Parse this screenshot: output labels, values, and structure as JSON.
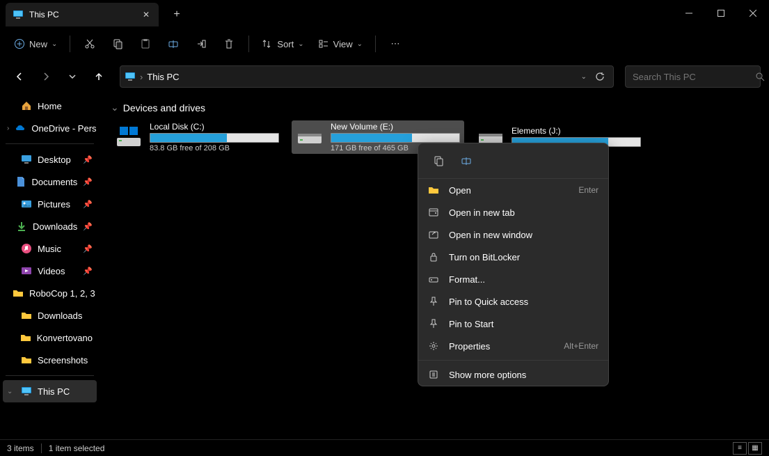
{
  "tab": {
    "title": "This PC"
  },
  "toolbar": {
    "new_label": "New",
    "sort_label": "Sort",
    "view_label": "View"
  },
  "address": {
    "location": "This PC",
    "separator": "›"
  },
  "search": {
    "placeholder": "Search This PC"
  },
  "sidebar": {
    "home": "Home",
    "onedrive": "OneDrive - Pers",
    "desktop": "Desktop",
    "documents": "Documents",
    "pictures": "Pictures",
    "downloads": "Downloads",
    "music": "Music",
    "videos": "Videos",
    "robocop": "RoboCop 1, 2, 3",
    "downloads2": "Downloads",
    "konvertovano": "Konvertovano",
    "screenshots": "Screenshots",
    "thispc": "This PC"
  },
  "group": {
    "title": "Devices and drives"
  },
  "drives": [
    {
      "name": "Local Disk (C:)",
      "free": "83.8 GB free of 208 GB",
      "fill": 60
    },
    {
      "name": "New Volume (E:)",
      "free": "171 GB free of 465 GB",
      "fill": 63
    },
    {
      "name": "Elements (J:)",
      "free": "",
      "fill": 75
    }
  ],
  "ctx": {
    "open": "Open",
    "open_shortcut": "Enter",
    "open_new_tab": "Open in new tab",
    "open_new_window": "Open in new window",
    "bitlocker": "Turn on BitLocker",
    "format": "Format...",
    "pin_quick": "Pin to Quick access",
    "pin_start": "Pin to Start",
    "properties": "Properties",
    "properties_shortcut": "Alt+Enter",
    "show_more": "Show more options"
  },
  "status": {
    "items": "3 items",
    "selected": "1 item selected"
  }
}
